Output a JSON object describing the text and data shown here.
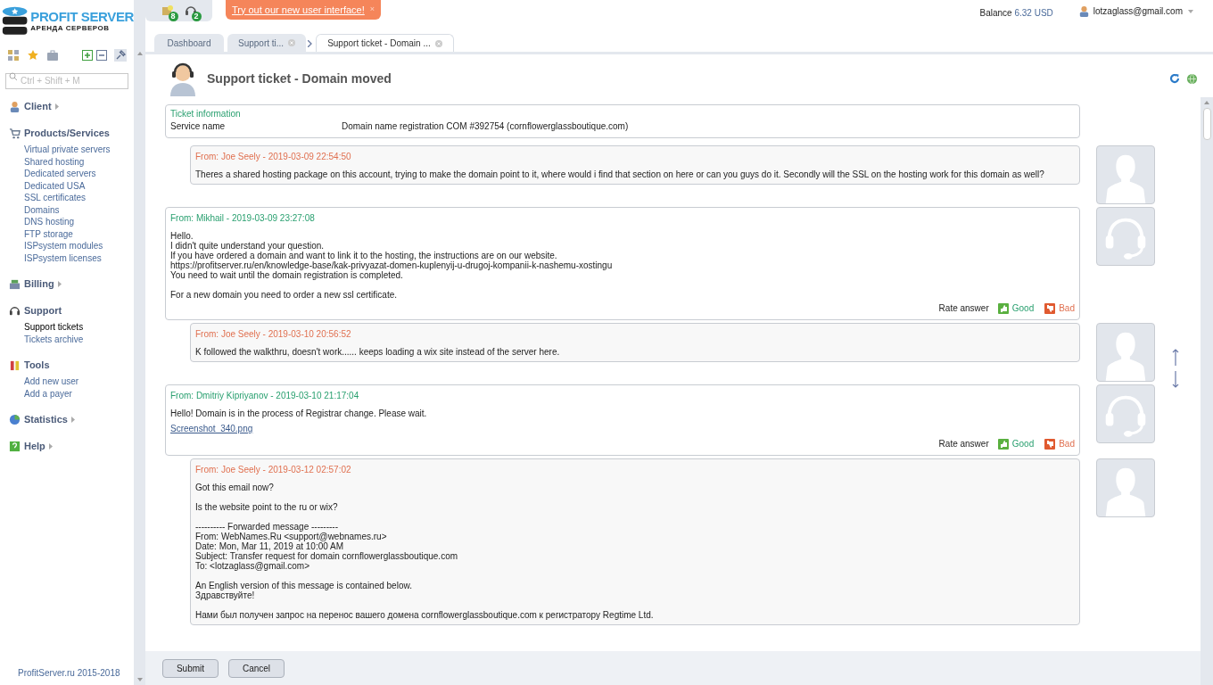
{
  "logo": {
    "name": "PROFIT SERVER",
    "tagline": "АРЕНДА СЕРВЕРОВ"
  },
  "top_icons": [
    {
      "kind": "notes",
      "count": "8"
    },
    {
      "kind": "support",
      "count": "2"
    }
  ],
  "banner": {
    "text": "Try out our new user interface!",
    "close": "×"
  },
  "account": {
    "balance_label": "Balance",
    "balance": "6.32 USD",
    "user": "lotzaglass@gmail.com"
  },
  "tabs": [
    {
      "label": "Dashboard",
      "selected": false,
      "closable": false
    },
    {
      "label": "Support ti...",
      "selected": false,
      "closable": true
    },
    {
      "label": "Support ticket - Domain ...",
      "selected": true,
      "closable": true
    }
  ],
  "sidebar": {
    "search": {
      "placeholder": "Ctrl + Shift + M"
    },
    "groups": [
      {
        "label": "Client",
        "expanded": false
      },
      {
        "label": "Products/Services",
        "expanded": true,
        "items": [
          {
            "label": "Virtual private servers",
            "selected": false
          },
          {
            "label": "Shared hosting",
            "selected": false
          },
          {
            "label": "Dedicated servers",
            "selected": false
          },
          {
            "label": "Dedicated USA",
            "selected": false
          },
          {
            "label": "SSL certificates",
            "selected": false
          },
          {
            "label": "Domains",
            "selected": false
          },
          {
            "label": "DNS hosting",
            "selected": false
          },
          {
            "label": "FTP storage",
            "selected": false
          },
          {
            "label": "ISPsystem modules",
            "selected": false
          },
          {
            "label": "ISPsystem licenses",
            "selected": false
          }
        ]
      },
      {
        "label": "Billing",
        "expanded": false
      },
      {
        "label": "Support",
        "expanded": true,
        "items": [
          {
            "label": "Support tickets",
            "selected": true
          },
          {
            "label": "Tickets archive",
            "selected": false
          }
        ]
      },
      {
        "label": "Tools",
        "expanded": true,
        "items": [
          {
            "label": "Add new user",
            "selected": false
          },
          {
            "label": "Add a payer",
            "selected": false
          }
        ]
      },
      {
        "label": "Statistics",
        "expanded": false
      },
      {
        "label": "Help",
        "expanded": false
      }
    ],
    "footer": "ProfitServer.ru 2015-2018"
  },
  "page": {
    "title": "Support ticket - Domain moved"
  },
  "ticket_info": {
    "title": "Ticket information",
    "label": "Service name",
    "value": "Domain name registration COM #392754 (cornflowerglassboutique.com)"
  },
  "messages": [
    {
      "kind": "client",
      "header": "From: Joe Seely - 2019-03-09 22:54:50",
      "paragraphs": [
        [
          "Theres a shared hosting package on this account, trying to make the domain point to it, where would i find that section on here or can you guys do it. Secondly will the SSL on the hosting work for this domain as well?"
        ]
      ]
    },
    {
      "kind": "staff",
      "header": "From: Mikhail - 2019-03-09 23:27:08",
      "paragraphs": [
        [
          "Hello.",
          "I didn't quite understand your question.",
          "If you have ordered a domain and want to link it to the hosting, the instructions are on our website.",
          "https://profitserver.ru/en/knowledge-base/kak-privyazat-domen-kuplenyij-u-drugoj-kompanii-k-nashemu-xostingu",
          "You need to wait until the domain registration is completed."
        ],
        [
          "For a new domain you need to order a new ssl certificate."
        ]
      ],
      "rate": {
        "label": "Rate answer",
        "good": "Good",
        "bad": "Bad"
      }
    },
    {
      "kind": "client",
      "header": "From: Joe Seely - 2019-03-10 20:56:52",
      "paragraphs": [
        [
          "K followed the walkthru, doesn't work...... keeps loading a wix site instead of the server here."
        ]
      ]
    },
    {
      "kind": "staff",
      "header": "From: Dmitriy Kipriyanov - 2019-03-10 21:17:04",
      "paragraphs": [
        [
          "Hello! Domain is in the process of Registrar change. Please wait."
        ]
      ],
      "attachment": "Screenshot_340.png",
      "rate": {
        "label": "Rate answer",
        "good": "Good",
        "bad": "Bad"
      }
    },
    {
      "kind": "client",
      "header": "From: Joe Seely - 2019-03-12 02:57:02",
      "paragraphs": [
        [
          "Got this email now?"
        ],
        [
          "Is the website point to the ru or wix?"
        ],
        [
          "---------- Forwarded message ---------",
          "From: WebNames.Ru <support@webnames.ru>",
          "Date: Mon, Mar 11, 2019 at 10:00 AM",
          "Subject: Transfer request for domain cornflowerglassboutique.com",
          "To: <lotzaglass@gmail.com>"
        ],
        [
          "An English version of this message is contained below.",
          "Здравствуйте!"
        ],
        [
          "Нами был получен запрос на перенос вашего домена cornflowerglassboutique.com к регистратору Regtime Ltd."
        ]
      ]
    }
  ],
  "buttons": [
    {
      "label": "Submit"
    },
    {
      "label": "Cancel"
    }
  ]
}
